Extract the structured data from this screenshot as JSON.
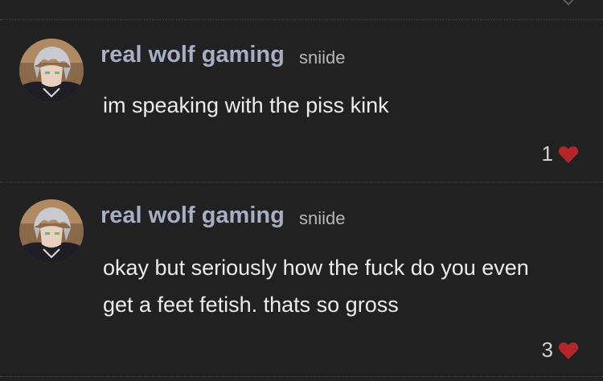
{
  "posts": [
    {
      "author": "real wolf gaming",
      "handle": "sniide",
      "text": "im speaking with the piss kink",
      "likes": "1"
    },
    {
      "author": "real wolf gaming",
      "handle": "sniide",
      "text": "okay but seriously how the fuck do you even get a feet fetish. thats so gross",
      "likes": "3"
    }
  ],
  "colors": {
    "background": "#212121",
    "username": "#a8aec4",
    "heart": "#b3262a"
  },
  "icons": {
    "like": "heart-icon",
    "more": "chevron-down-icon"
  }
}
